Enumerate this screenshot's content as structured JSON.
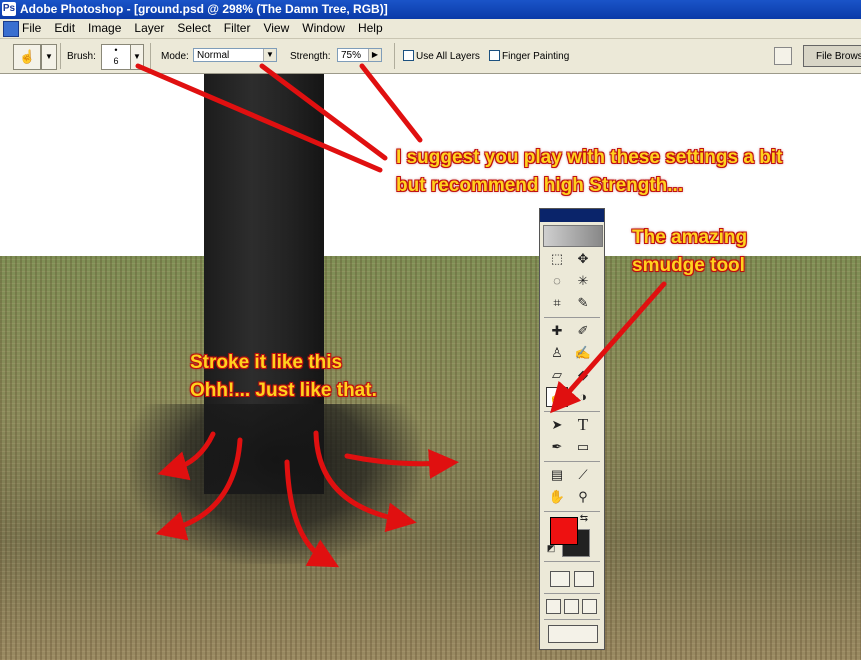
{
  "window": {
    "title": "Adobe Photoshop - [ground.psd @ 298% (The Damn Tree, RGB)]",
    "logo_icon": "photoshop-logo-icon"
  },
  "menu": [
    "File",
    "Edit",
    "Image",
    "Layer",
    "Select",
    "Filter",
    "View",
    "Window",
    "Help"
  ],
  "options": {
    "brush_label": "Brush:",
    "brush_size": "6",
    "mode_label": "Mode:",
    "mode_value": "Normal",
    "strength_label": "Strength:",
    "strength_value": "75%",
    "use_all_layers_label": "Use All Layers",
    "finger_painting_label": "Finger Painting",
    "file_browser_label": "File Brows"
  },
  "annotations": {
    "settings_line1": "I suggest you play with these settings a bit",
    "settings_line2": "but recommend high Strength...",
    "smudge_line1": "The amazing",
    "smudge_line2": "smudge tool",
    "stroke_line1": "Stroke it like this",
    "stroke_line2": "Ohh!... Just like that."
  },
  "colors": {
    "annotation_text": "#ffd21e",
    "annotation_outline": "#c01010",
    "arrow": "#e01010",
    "foreground": "#ee1111",
    "background": "#222222"
  },
  "tools": {
    "type_glyph": "T"
  }
}
